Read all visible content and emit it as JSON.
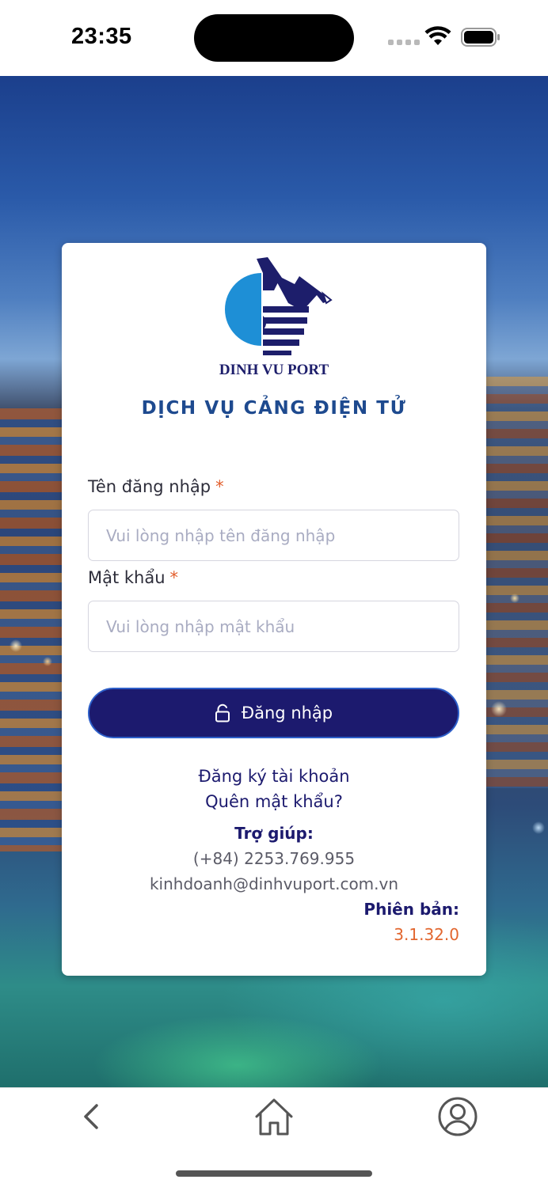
{
  "status_bar": {
    "time": "23:35",
    "icons": [
      "cellular-icon",
      "wifi-icon",
      "battery-icon"
    ]
  },
  "brand": {
    "logo_text": "DINH VU PORT",
    "service_title": "DỊCH VỤ CẢNG ĐIỆN TỬ",
    "colors": {
      "navy": "#1c1a6e",
      "logo_blue": "#1e8fd6",
      "accent_orange": "#e2662e"
    }
  },
  "form": {
    "username": {
      "label": "Tên đăng nhập",
      "required_mark": "*",
      "value": "",
      "placeholder": "Vui lòng nhập tên đăng nhập"
    },
    "password": {
      "label": "Mật khẩu",
      "required_mark": "*",
      "value": "",
      "placeholder": "Vui lòng nhập mật khẩu"
    },
    "login_button": {
      "icon": "unlock-icon",
      "label": "Đăng nhập"
    }
  },
  "links": {
    "register": "Đăng ký tài khoản",
    "forgot_password": "Quên mật khẩu?"
  },
  "help": {
    "title": "Trợ giúp:",
    "phone": "(+84) 2253.769.955",
    "email": "kinhdoanh@dinhvuport.com.vn"
  },
  "version": {
    "label": "Phiên bản:",
    "value": "3.1.32.0"
  },
  "bottom_nav": {
    "items": [
      {
        "icon": "chevron-left-icon"
      },
      {
        "icon": "home-icon"
      },
      {
        "icon": "user-circle-icon"
      }
    ]
  }
}
